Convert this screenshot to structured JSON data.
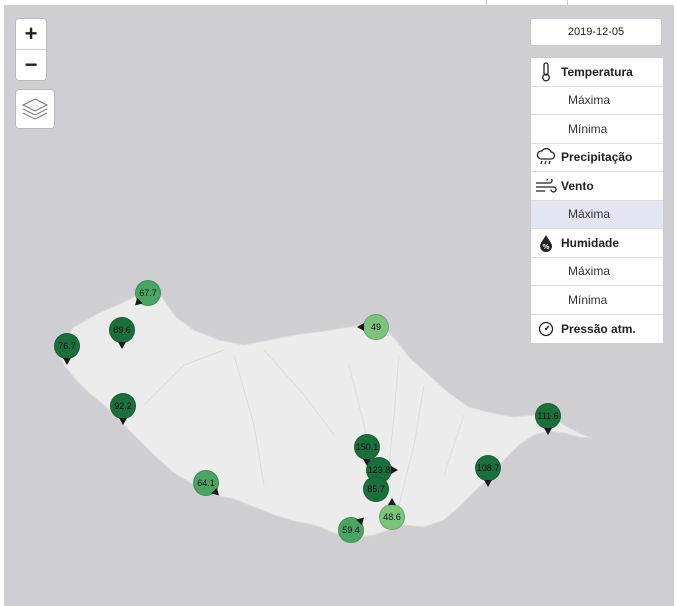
{
  "date": "2019-12-05",
  "zoom": {
    "in_label": "+",
    "out_label": "−"
  },
  "menu": [
    {
      "type": "category",
      "label": "Temperatura",
      "icon": "thermometer-icon"
    },
    {
      "type": "sub",
      "label": "Máxima",
      "active": false
    },
    {
      "type": "sub",
      "label": "Mínima",
      "active": false
    },
    {
      "type": "category",
      "label": "Precipitação",
      "icon": "rain-cloud-icon"
    },
    {
      "type": "category",
      "label": "Vento",
      "icon": "wind-icon"
    },
    {
      "type": "sub",
      "label": "Máxima",
      "active": true
    },
    {
      "type": "category",
      "label": "Humidade",
      "icon": "humidity-drop-icon"
    },
    {
      "type": "sub",
      "label": "Máxima",
      "active": false
    },
    {
      "type": "sub",
      "label": "Mínima",
      "active": false
    },
    {
      "type": "category",
      "label": "Pressão atm.",
      "icon": "gauge-icon"
    }
  ],
  "colors": {
    "dark": "#1a6f3c",
    "medium": "#4aa564",
    "light": "#7cc47e"
  },
  "stations": [
    {
      "value": "67.7",
      "shade": "medium",
      "dir": "sw"
    },
    {
      "value": "89.6",
      "shade": "dark",
      "dir": "s"
    },
    {
      "value": "76.7",
      "shade": "dark",
      "dir": "s"
    },
    {
      "value": "92.2",
      "shade": "dark",
      "dir": "s"
    },
    {
      "value": "64.1",
      "shade": "medium",
      "dir": "se"
    },
    {
      "value": "49",
      "shade": "light",
      "dir": "w"
    },
    {
      "value": "150.1",
      "shade": "dark",
      "dir": "s"
    },
    {
      "value": "123.8",
      "shade": "dark",
      "dir": "e"
    },
    {
      "value": "85.7",
      "shade": "dark",
      "dir": "none"
    },
    {
      "value": "48.6",
      "shade": "light",
      "dir": "n"
    },
    {
      "value": "59.4",
      "shade": "medium",
      "dir": "ne"
    },
    {
      "value": "108.7",
      "shade": "dark",
      "dir": "s"
    },
    {
      "value": "111.6",
      "shade": "dark",
      "dir": "s"
    }
  ]
}
